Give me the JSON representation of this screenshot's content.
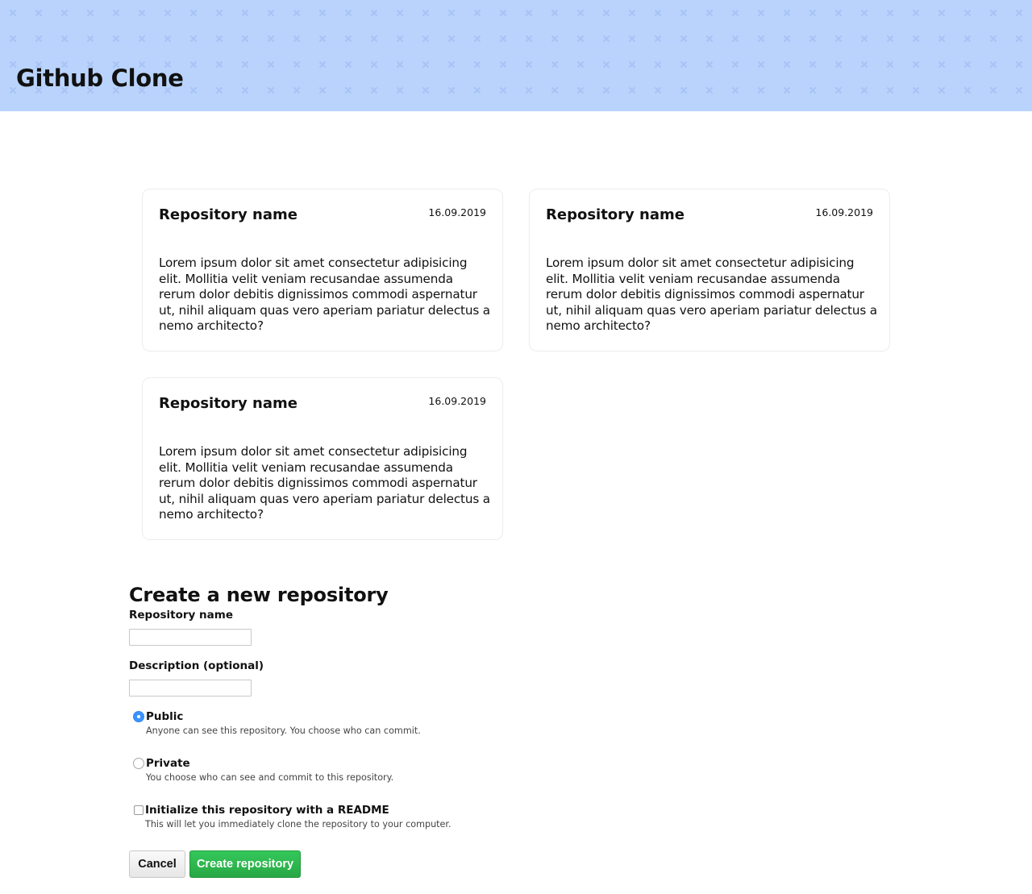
{
  "header": {
    "title": "Github Clone",
    "background_color": "#b9d3fd"
  },
  "repositories": [
    {
      "name": "Repository name",
      "date": "16.09.2019",
      "description": "Lorem ipsum dolor sit amet consectetur adipisicing elit. Mollitia velit veniam recusandae assumenda rerum dolor debitis dignissimos commodi aspernatur ut, nihil aliquam quas vero aperiam pariatur delectus a nemo architecto?"
    },
    {
      "name": "Repository name",
      "date": "16.09.2019",
      "description": "Lorem ipsum dolor sit amet consectetur adipisicing elit. Mollitia velit veniam recusandae assumenda rerum dolor debitis dignissimos commodi aspernatur ut, nihil aliquam quas vero aperiam pariatur delectus a nemo architecto?"
    },
    {
      "name": "Repository name",
      "date": "16.09.2019",
      "description": "Lorem ipsum dolor sit amet consectetur adipisicing elit. Mollitia velit veniam recusandae assumenda rerum dolor debitis dignissimos commodi aspernatur ut, nihil aliquam quas vero aperiam pariatur delectus a nemo architecto?"
    }
  ],
  "form": {
    "title": "Create a new repository",
    "name_label": "Repository name",
    "name_value": "",
    "description_label": "Description (optional)",
    "description_value": "",
    "visibility": {
      "public_label": "Public",
      "public_note": "Anyone can see this repository. You choose who can commit.",
      "private_label": "Private",
      "private_note": "You choose who can see and commit to this repository.",
      "selected": "public"
    },
    "readme": {
      "label": "Initialize this repository with a README",
      "note": "This will let you immediately clone the repository to your computer.",
      "checked": false
    },
    "cancel_label": "Cancel",
    "create_label": "Create repository",
    "create_color": "#28a745"
  }
}
